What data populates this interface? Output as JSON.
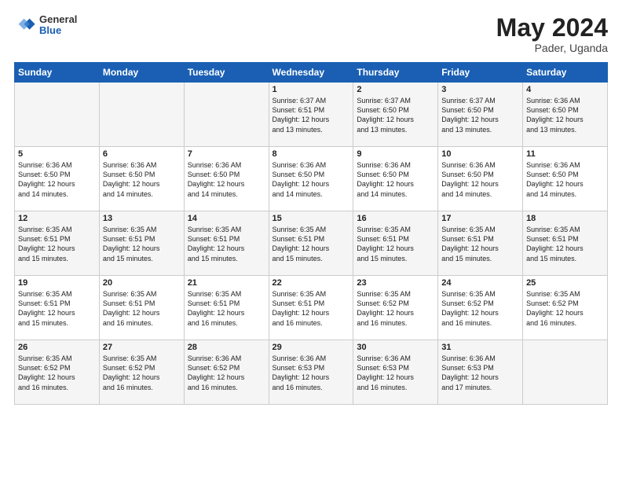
{
  "logo": {
    "line1": "General",
    "line2": "Blue"
  },
  "title": {
    "month_year": "May 2024",
    "location": "Pader, Uganda"
  },
  "weekdays": [
    "Sunday",
    "Monday",
    "Tuesday",
    "Wednesday",
    "Thursday",
    "Friday",
    "Saturday"
  ],
  "weeks": [
    [
      {
        "day": "",
        "info": ""
      },
      {
        "day": "",
        "info": ""
      },
      {
        "day": "",
        "info": ""
      },
      {
        "day": "1",
        "info": "Sunrise: 6:37 AM\nSunset: 6:51 PM\nDaylight: 12 hours\nand 13 minutes."
      },
      {
        "day": "2",
        "info": "Sunrise: 6:37 AM\nSunset: 6:50 PM\nDaylight: 12 hours\nand 13 minutes."
      },
      {
        "day": "3",
        "info": "Sunrise: 6:37 AM\nSunset: 6:50 PM\nDaylight: 12 hours\nand 13 minutes."
      },
      {
        "day": "4",
        "info": "Sunrise: 6:36 AM\nSunset: 6:50 PM\nDaylight: 12 hours\nand 13 minutes."
      }
    ],
    [
      {
        "day": "5",
        "info": "Sunrise: 6:36 AM\nSunset: 6:50 PM\nDaylight: 12 hours\nand 14 minutes."
      },
      {
        "day": "6",
        "info": "Sunrise: 6:36 AM\nSunset: 6:50 PM\nDaylight: 12 hours\nand 14 minutes."
      },
      {
        "day": "7",
        "info": "Sunrise: 6:36 AM\nSunset: 6:50 PM\nDaylight: 12 hours\nand 14 minutes."
      },
      {
        "day": "8",
        "info": "Sunrise: 6:36 AM\nSunset: 6:50 PM\nDaylight: 12 hours\nand 14 minutes."
      },
      {
        "day": "9",
        "info": "Sunrise: 6:36 AM\nSunset: 6:50 PM\nDaylight: 12 hours\nand 14 minutes."
      },
      {
        "day": "10",
        "info": "Sunrise: 6:36 AM\nSunset: 6:50 PM\nDaylight: 12 hours\nand 14 minutes."
      },
      {
        "day": "11",
        "info": "Sunrise: 6:36 AM\nSunset: 6:50 PM\nDaylight: 12 hours\nand 14 minutes."
      }
    ],
    [
      {
        "day": "12",
        "info": "Sunrise: 6:35 AM\nSunset: 6:51 PM\nDaylight: 12 hours\nand 15 minutes."
      },
      {
        "day": "13",
        "info": "Sunrise: 6:35 AM\nSunset: 6:51 PM\nDaylight: 12 hours\nand 15 minutes."
      },
      {
        "day": "14",
        "info": "Sunrise: 6:35 AM\nSunset: 6:51 PM\nDaylight: 12 hours\nand 15 minutes."
      },
      {
        "day": "15",
        "info": "Sunrise: 6:35 AM\nSunset: 6:51 PM\nDaylight: 12 hours\nand 15 minutes."
      },
      {
        "day": "16",
        "info": "Sunrise: 6:35 AM\nSunset: 6:51 PM\nDaylight: 12 hours\nand 15 minutes."
      },
      {
        "day": "17",
        "info": "Sunrise: 6:35 AM\nSunset: 6:51 PM\nDaylight: 12 hours\nand 15 minutes."
      },
      {
        "day": "18",
        "info": "Sunrise: 6:35 AM\nSunset: 6:51 PM\nDaylight: 12 hours\nand 15 minutes."
      }
    ],
    [
      {
        "day": "19",
        "info": "Sunrise: 6:35 AM\nSunset: 6:51 PM\nDaylight: 12 hours\nand 15 minutes."
      },
      {
        "day": "20",
        "info": "Sunrise: 6:35 AM\nSunset: 6:51 PM\nDaylight: 12 hours\nand 16 minutes."
      },
      {
        "day": "21",
        "info": "Sunrise: 6:35 AM\nSunset: 6:51 PM\nDaylight: 12 hours\nand 16 minutes."
      },
      {
        "day": "22",
        "info": "Sunrise: 6:35 AM\nSunset: 6:51 PM\nDaylight: 12 hours\nand 16 minutes."
      },
      {
        "day": "23",
        "info": "Sunrise: 6:35 AM\nSunset: 6:52 PM\nDaylight: 12 hours\nand 16 minutes."
      },
      {
        "day": "24",
        "info": "Sunrise: 6:35 AM\nSunset: 6:52 PM\nDaylight: 12 hours\nand 16 minutes."
      },
      {
        "day": "25",
        "info": "Sunrise: 6:35 AM\nSunset: 6:52 PM\nDaylight: 12 hours\nand 16 minutes."
      }
    ],
    [
      {
        "day": "26",
        "info": "Sunrise: 6:35 AM\nSunset: 6:52 PM\nDaylight: 12 hours\nand 16 minutes."
      },
      {
        "day": "27",
        "info": "Sunrise: 6:35 AM\nSunset: 6:52 PM\nDaylight: 12 hours\nand 16 minutes."
      },
      {
        "day": "28",
        "info": "Sunrise: 6:36 AM\nSunset: 6:52 PM\nDaylight: 12 hours\nand 16 minutes."
      },
      {
        "day": "29",
        "info": "Sunrise: 6:36 AM\nSunset: 6:53 PM\nDaylight: 12 hours\nand 16 minutes."
      },
      {
        "day": "30",
        "info": "Sunrise: 6:36 AM\nSunset: 6:53 PM\nDaylight: 12 hours\nand 16 minutes."
      },
      {
        "day": "31",
        "info": "Sunrise: 6:36 AM\nSunset: 6:53 PM\nDaylight: 12 hours\nand 17 minutes."
      },
      {
        "day": "",
        "info": ""
      }
    ]
  ]
}
